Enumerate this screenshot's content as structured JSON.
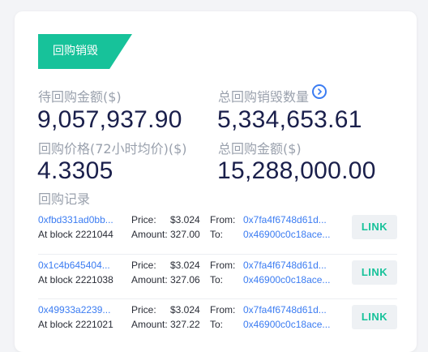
{
  "banner": {
    "title": "回购销毁"
  },
  "stats": {
    "pending_buyback_label": "待回购金额($)",
    "pending_buyback_value": "9,057,937.90",
    "total_burn_label": "总回购销毁数量",
    "total_burn_value": "5,334,653.61",
    "buyback_price_label": "回购价格(72小时均价)($)",
    "buyback_price_value": "4.3305",
    "total_buyback_label": "总回购金额($)",
    "total_buyback_value": "15,288,000.00"
  },
  "records": {
    "title": "回购记录",
    "price_label": "Price:",
    "amount_label": "Amount:",
    "from_label": "From:",
    "to_label": "To:",
    "link_label": "LINK",
    "items": [
      {
        "tx": "0xfbd331ad0bb...",
        "block": "At block 2221044",
        "price": "$3.024",
        "amount": "327.00",
        "from": "0x7fa4f6748d61d...",
        "to": "0x46900c0c18ace..."
      },
      {
        "tx": "0x1c4b645404...",
        "block": "At block 2221038",
        "price": "$3.024",
        "amount": "327.06",
        "from": "0x7fa4f6748d61d...",
        "to": "0x46900c0c18ace..."
      },
      {
        "tx": "0x49933a2239...",
        "block": "At block 2221021",
        "price": "$3.024",
        "amount": "327.22",
        "from": "0x7fa4f6748d61d...",
        "to": "0x46900c0c18ace..."
      }
    ]
  },
  "colors": {
    "accent": "#17c29a",
    "link": "#3b7cf2",
    "value": "#1a1f4b",
    "label": "#9aa1ad"
  },
  "icons": {
    "info": "chevron-right-circle-icon"
  }
}
